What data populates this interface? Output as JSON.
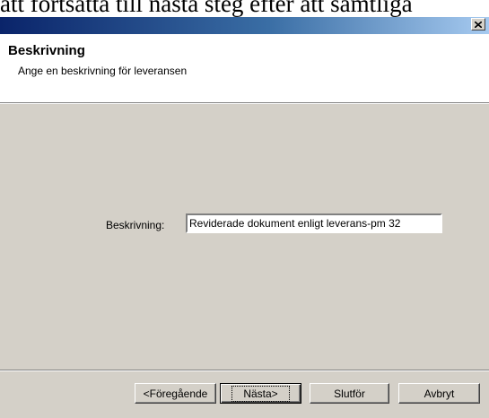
{
  "document_text": "att fortsätta till nästa steg efter att samtliga",
  "dialog": {
    "close_icon": "close-icon",
    "header": {
      "title": "Beskrivning",
      "subtitle": "Ange en beskrivning för leveransen"
    },
    "form": {
      "description_label": "Beskrivning:",
      "description_value": "Reviderade dokument enligt leverans-pm 32"
    },
    "buttons": {
      "previous": "<Föregående",
      "next": "Nästa>",
      "finish": "Slutför",
      "cancel": "Avbryt"
    }
  }
}
